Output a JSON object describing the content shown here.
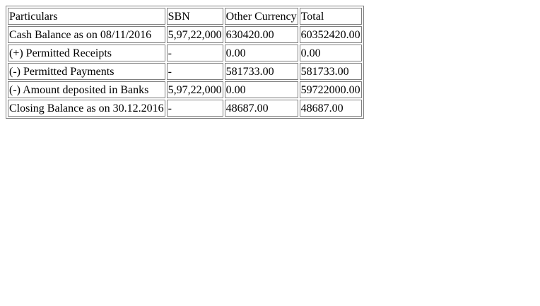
{
  "table": {
    "headers": [
      "Particulars",
      "SBN",
      "Other Currency",
      "Total"
    ],
    "rows": [
      [
        "Cash Balance as on 08/11/2016",
        "5,97,22,000",
        "630420.00",
        "60352420.00"
      ],
      [
        "(+) Permitted Receipts",
        "-",
        "0.00",
        "0.00"
      ],
      [
        "(-) Permitted Payments",
        "-",
        "581733.00",
        "581733.00"
      ],
      [
        "(-) Amount deposited in Banks",
        "5,97,22,000",
        "0.00",
        "59722000.00"
      ],
      [
        "Closing Balance as on 30.12.2016",
        "-",
        "48687.00",
        "48687.00"
      ]
    ]
  }
}
